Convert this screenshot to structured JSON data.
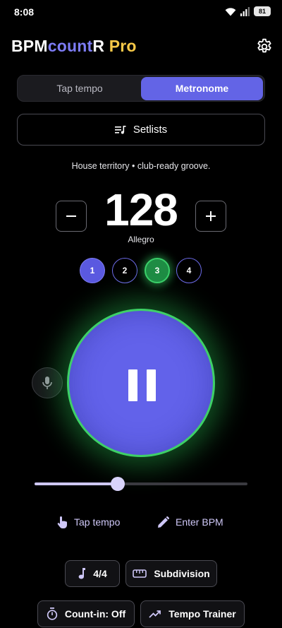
{
  "status_bar": {
    "time": "8:08",
    "battery": "81",
    "icons": [
      "wifi-icon",
      "signal-icon",
      "battery-icon"
    ]
  },
  "header": {
    "title_parts": {
      "bpm": "BPM",
      "count": "count",
      "r": "R",
      "pro": "Pro"
    },
    "settings_icon": "gear-icon"
  },
  "tabs": [
    {
      "label": "Tap tempo",
      "active": false
    },
    {
      "label": "Metronome",
      "active": true
    }
  ],
  "setlists": {
    "label": "Setlists",
    "icon": "playlist-icon"
  },
  "subtitle": "House territory • club-ready groove.",
  "bpm": {
    "value": "128",
    "tempo_name": "Allegro",
    "minus_icon": "minus-icon",
    "plus_icon": "plus-icon"
  },
  "beats": [
    {
      "label": "1",
      "state": "accent"
    },
    {
      "label": "2",
      "state": "idle"
    },
    {
      "label": "3",
      "state": "current"
    },
    {
      "label": "4",
      "state": "idle"
    }
  ],
  "play_button": {
    "icon": "pause-icon",
    "playing": true
  },
  "mic": {
    "icon": "microphone-icon"
  },
  "slider": {
    "fraction": 0.39
  },
  "actions": {
    "tap_tempo": {
      "label": "Tap tempo",
      "icon": "hand-tap-icon"
    },
    "enter_bpm": {
      "label": "Enter BPM",
      "icon": "pencil-icon"
    }
  },
  "chips": {
    "time_signature": {
      "label": "4/4",
      "icon": "music-note-icon"
    },
    "subdivision": {
      "label": "Subdivision",
      "icon": "ruler-icon"
    },
    "count_in": {
      "label": "Count-in: Off",
      "icon": "timer-icon"
    },
    "tempo_trainer": {
      "label": "Tempo Trainer",
      "icon": "trending-up-icon"
    }
  },
  "colors": {
    "accent": "#6364e6",
    "active_beat": "#3ed067",
    "pro": "#f7c948",
    "link": "#cfc8f8"
  }
}
